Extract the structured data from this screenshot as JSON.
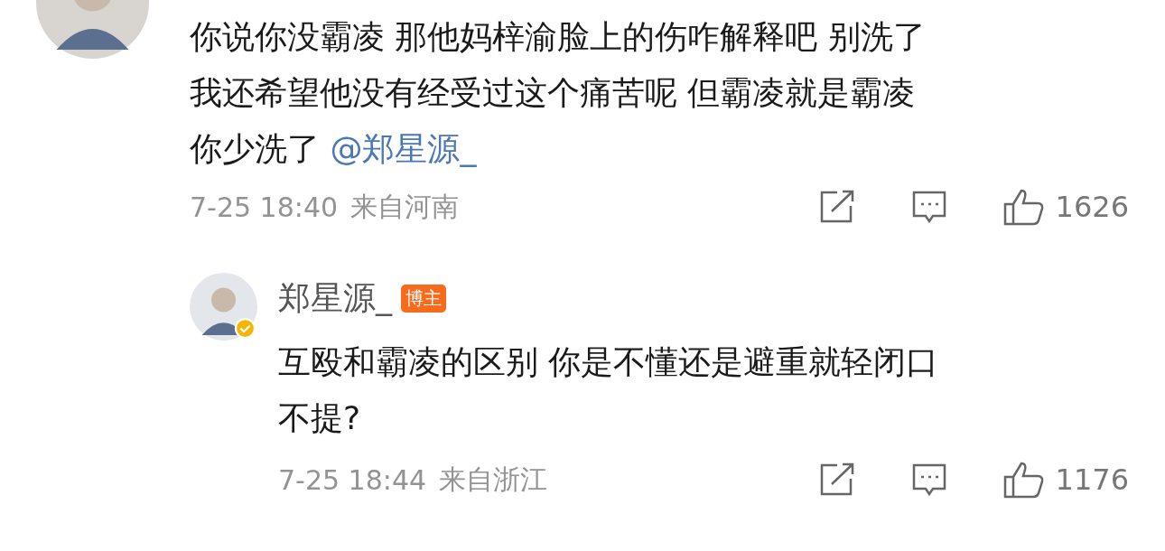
{
  "comment": {
    "lines": [
      "你说你没霸凌 那他妈梓渝脸上的伤咋解释吧 别洗了",
      "我还希望他没有经受过这个痛苦呢 但霸凌就是霸凌",
      "你少洗了 "
    ],
    "mention": "@郑星源_",
    "time": "7-25 18:40",
    "location": "来自河南",
    "likes": "1626"
  },
  "reply": {
    "author": "郑星源_",
    "badge": "博主",
    "verified": true,
    "lines": [
      "互殴和霸凌的区别 你是不懂还是避重就轻闭口",
      "不提?"
    ],
    "time": "7-25 18:44",
    "location": "来自浙江",
    "likes": "1176"
  }
}
